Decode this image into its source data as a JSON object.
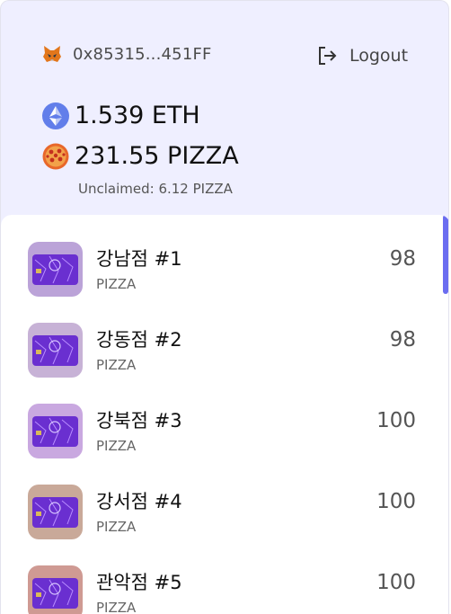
{
  "wallet": {
    "address": "0x85315...451FF",
    "icon": "metamask-fox-icon"
  },
  "logout": {
    "label": "Logout",
    "icon": "logout-icon"
  },
  "balances": {
    "eth": {
      "text": "1.539 ETH",
      "icon": "ethereum-icon"
    },
    "pizza": {
      "text": "231.55 PIZZA",
      "icon": "pizza-icon"
    },
    "unclaimed": "Unclaimed: 6.12 PIZZA"
  },
  "colors": {
    "accent": "#6b6df0",
    "header_bg": "#efefff",
    "nft_purple": "#6a2fd0"
  },
  "items": [
    {
      "name": "강남점 #1",
      "sub": "PIZZA",
      "value": "98"
    },
    {
      "name": "강동점 #2",
      "sub": "PIZZA",
      "value": "98"
    },
    {
      "name": "강북점 #3",
      "sub": "PIZZA",
      "value": "100"
    },
    {
      "name": "강서점 #4",
      "sub": "PIZZA",
      "value": "100"
    },
    {
      "name": "관악점 #5",
      "sub": "PIZZA",
      "value": "100"
    }
  ]
}
